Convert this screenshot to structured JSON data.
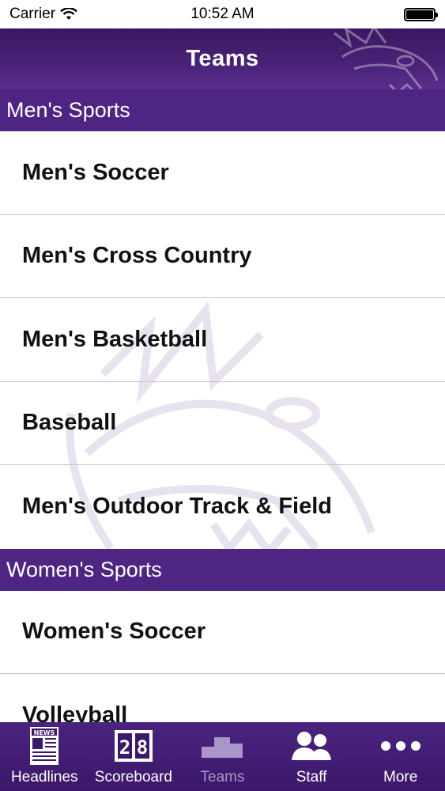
{
  "status_bar": {
    "carrier": "Carrier",
    "time": "10:52 AM"
  },
  "nav": {
    "title": "Teams"
  },
  "sections": [
    {
      "header": "Men's Sports",
      "items": [
        "Men's Soccer",
        "Men's Cross Country",
        "Men's Basketball",
        "Baseball",
        "Men's Outdoor Track & Field"
      ]
    },
    {
      "header": "Women's Sports",
      "items": [
        "Women's Soccer",
        "Volleyball"
      ]
    }
  ],
  "tabs": [
    {
      "label": "Headlines",
      "icon": "newspaper-icon"
    },
    {
      "label": "Scoreboard",
      "icon": "scoreboard-icon"
    },
    {
      "label": "Teams",
      "icon": "podium-icon"
    },
    {
      "label": "Staff",
      "icon": "staff-icon"
    },
    {
      "label": "More",
      "icon": "more-icon"
    }
  ],
  "colors": {
    "brand_purple": "#4e2582",
    "active_tab": "#a995c8"
  }
}
